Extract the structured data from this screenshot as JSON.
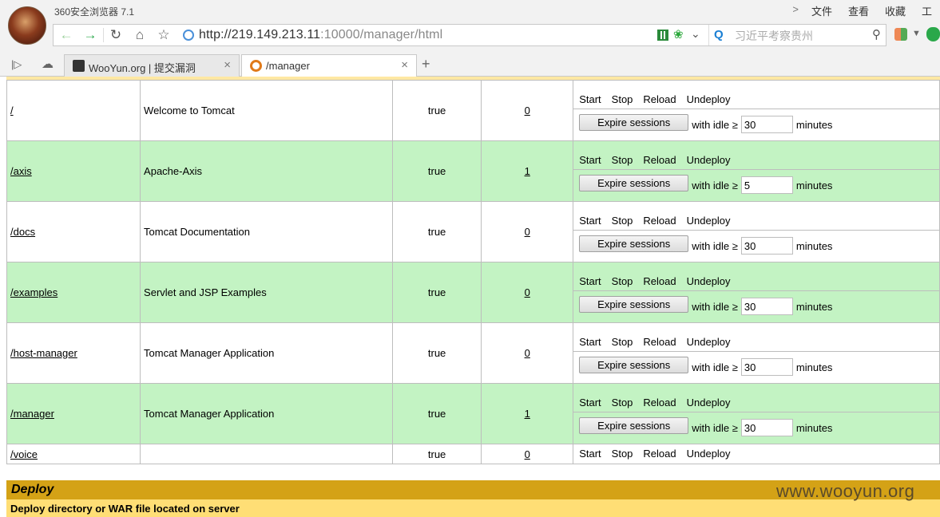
{
  "browser": {
    "app_title": "360安全浏览器 7.1",
    "menu": [
      "文件",
      "查看",
      "收藏",
      "工"
    ],
    "url_host": "http://219.149.213.11",
    "url_rest": ":10000/manager/html",
    "search_placeholder": "习近平考察贵州",
    "tabs": [
      {
        "label": "WooYun.org | 提交漏洞",
        "active": false
      },
      {
        "label": "/manager",
        "active": true
      }
    ],
    "new_tab_symbol": "+"
  },
  "applications": [
    {
      "path": "/",
      "name": "Welcome to Tomcat",
      "running": "true",
      "sessions": "0",
      "idle": "30",
      "commands": {
        "start": "Start",
        "stop": "Stop",
        "reload": "Reload",
        "undeploy": "Undeploy"
      }
    },
    {
      "path": "/axis",
      "name": "Apache-Axis",
      "running": "true",
      "sessions": "1",
      "idle": "5",
      "commands": {
        "start": "Start",
        "stop": "Stop",
        "reload": "Reload",
        "undeploy": "Undeploy"
      }
    },
    {
      "path": "/docs",
      "name": "Tomcat Documentation",
      "running": "true",
      "sessions": "0",
      "idle": "30",
      "commands": {
        "start": "Start",
        "stop": "Stop",
        "reload": "Reload",
        "undeploy": "Undeploy"
      }
    },
    {
      "path": "/examples",
      "name": "Servlet and JSP Examples",
      "running": "true",
      "sessions": "0",
      "idle": "30",
      "commands": {
        "start": "Start",
        "stop": "Stop",
        "reload": "Reload",
        "undeploy": "Undeploy"
      }
    },
    {
      "path": "/host-manager",
      "name": "Tomcat Manager Application",
      "running": "true",
      "sessions": "0",
      "idle": "30",
      "commands": {
        "start": "Start",
        "stop": "Stop",
        "reload": "Reload",
        "undeploy": "Undeploy"
      }
    },
    {
      "path": "/manager",
      "name": "Tomcat Manager Application",
      "running": "true",
      "sessions": "1",
      "idle": "30",
      "commands": {
        "start": "Start",
        "stop": "Stop",
        "reload": "Reload",
        "undeploy": "Undeploy"
      }
    },
    {
      "path": "/voice",
      "name": "",
      "running": "true",
      "sessions": "0",
      "idle": "",
      "commands": {
        "start": "Start",
        "stop": "Stop",
        "reload": "Reload",
        "undeploy": "Undeploy"
      }
    }
  ],
  "labels": {
    "expire_button": "Expire sessions",
    "with_idle": "with idle ≥",
    "minutes": "minutes"
  },
  "deploy": {
    "title": "Deploy",
    "subtitle": "Deploy directory or WAR file located on server"
  },
  "watermark": "www.wooyun.org",
  "colors": {
    "row_alt": "#c3f3c3",
    "deploy_header": "#d4a216",
    "deploy_sub": "#ffde75"
  }
}
